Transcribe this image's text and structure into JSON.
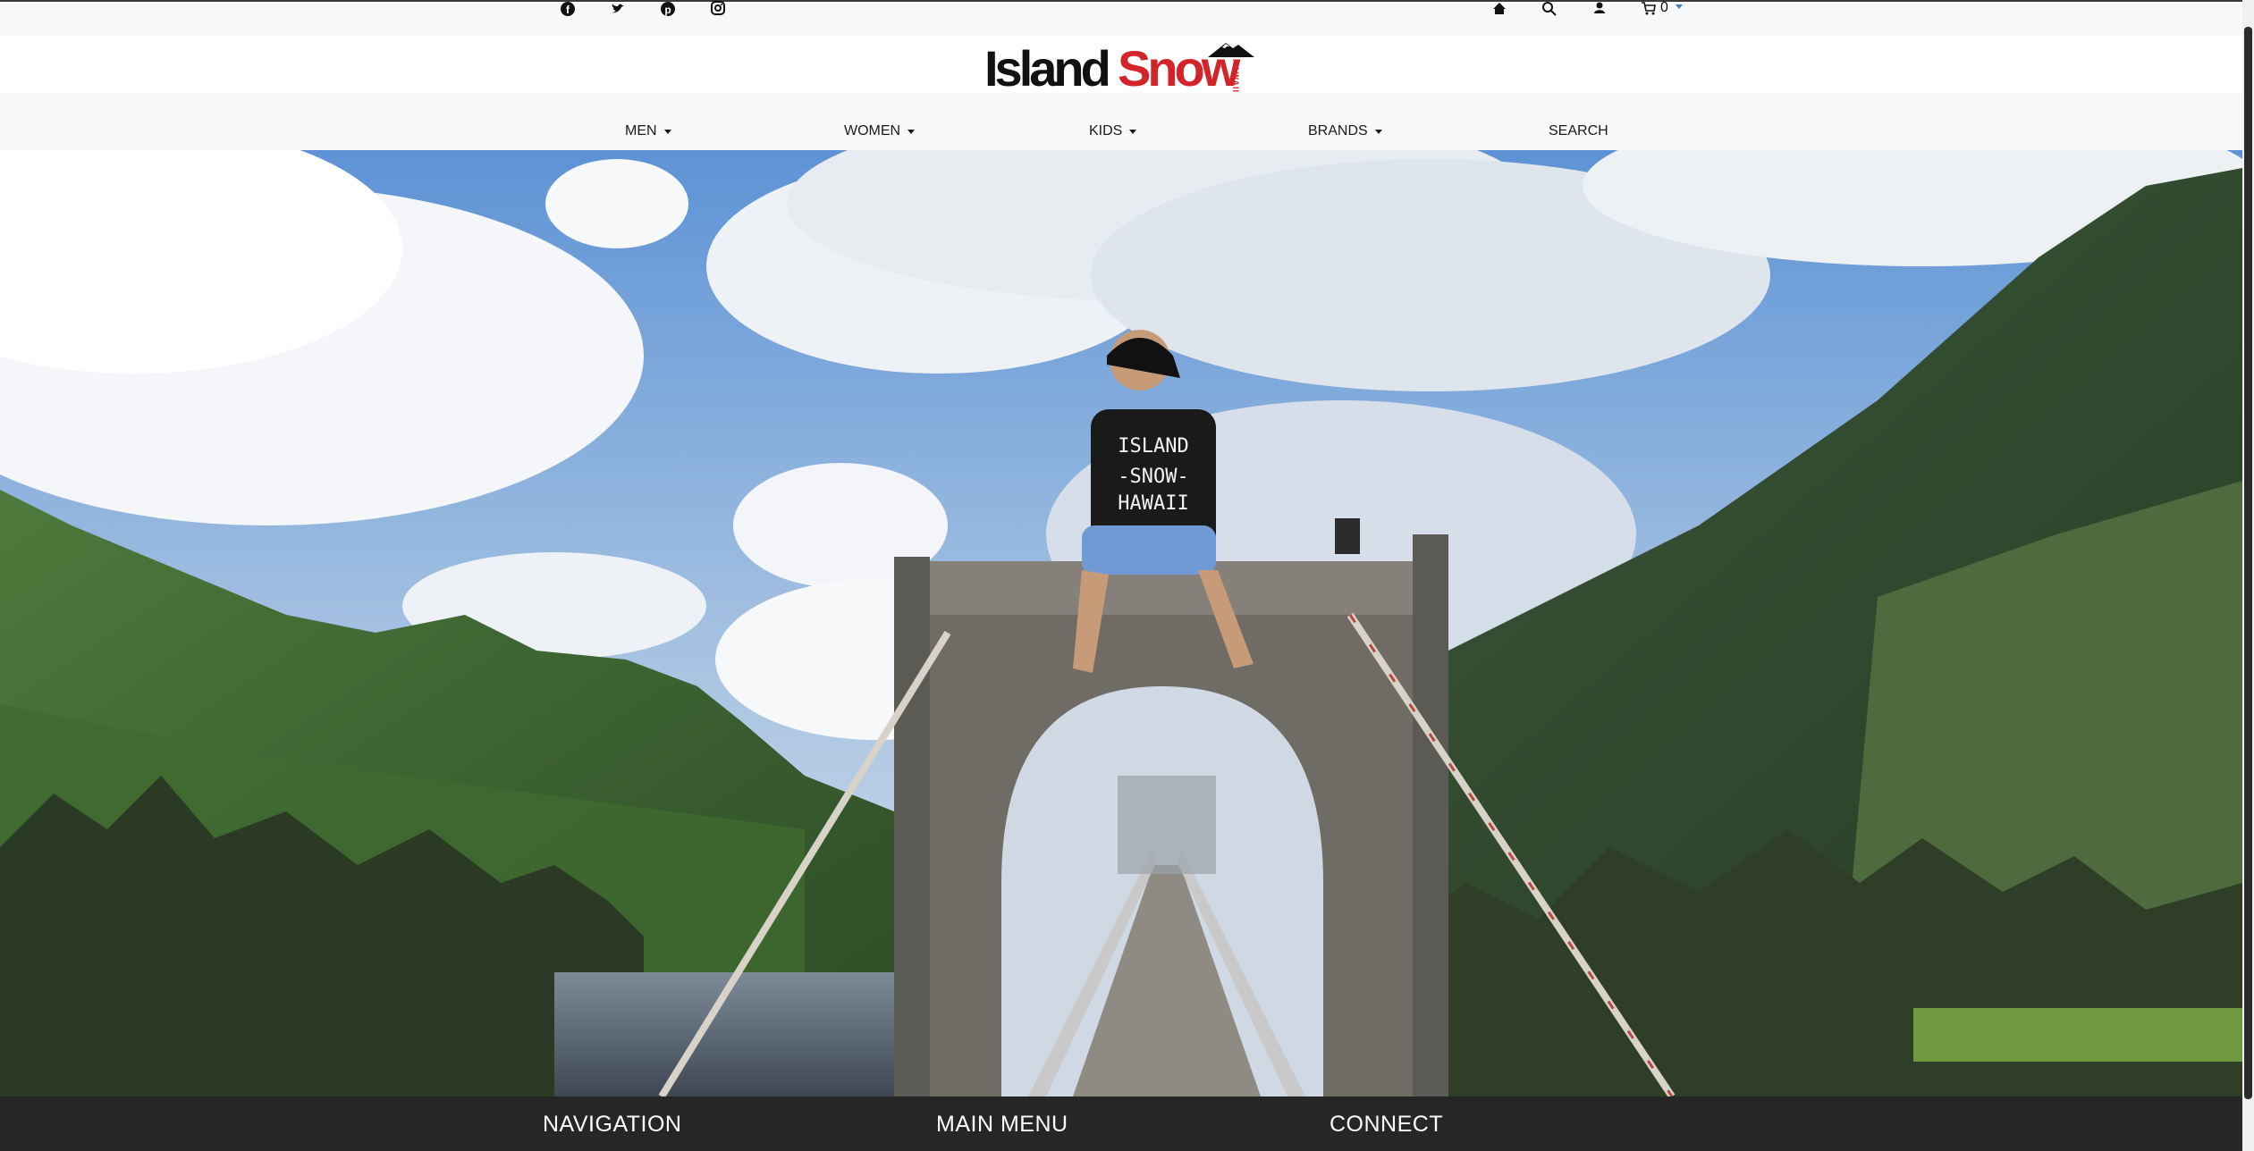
{
  "topbar": {
    "social_icons": [
      "facebook-icon",
      "twitter-icon",
      "pinterest-icon",
      "instagram-icon"
    ],
    "utility_icons": [
      "home-icon",
      "search-icon",
      "user-icon",
      "cart-icon"
    ],
    "cart_count": "0"
  },
  "brand": {
    "name_part1": "Island",
    "name_part2": "Snow",
    "tagline": "HAWAII",
    "accent_color": "#d3242b"
  },
  "nav": {
    "items": [
      {
        "label": "MEN",
        "dropdown": true
      },
      {
        "label": "WOMEN",
        "dropdown": true
      },
      {
        "label": "KIDS",
        "dropdown": true
      },
      {
        "label": "BRANDS",
        "dropdown": true
      },
      {
        "label": "SEARCH",
        "dropdown": false
      }
    ]
  },
  "hero": {
    "shirt_line1": "ISLAND",
    "shirt_line2": "-SNOW-",
    "shirt_line3": "HAWAII"
  },
  "footer": {
    "headings": [
      "NAVIGATION",
      "MAIN MENU",
      "CONNECT"
    ]
  }
}
